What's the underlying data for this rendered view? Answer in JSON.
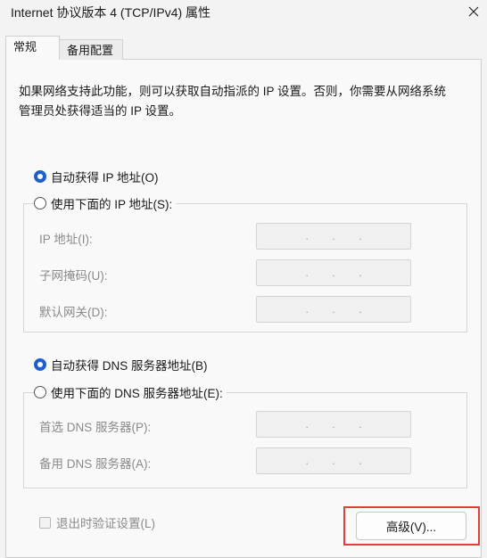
{
  "window": {
    "title": "Internet 协议版本 4 (TCP/IPv4) 属性"
  },
  "tabs": [
    {
      "label": "常规",
      "active": true
    },
    {
      "label": "备用配置",
      "active": false
    }
  ],
  "description": "如果网络支持此功能，则可以获取自动指派的 IP 设置。否则，你需要从网络系统管理员处获得适当的 IP 设置。",
  "ip": {
    "auto_label": "自动获得 IP 地址(O)",
    "auto_selected": true,
    "manual_label": "使用下面的 IP 地址(S):",
    "fields": [
      {
        "label": "IP 地址(I):",
        "value": ". . ."
      },
      {
        "label": "子网掩码(U):",
        "value": ". . ."
      },
      {
        "label": "默认网关(D):",
        "value": ". . ."
      }
    ]
  },
  "dns": {
    "auto_label": "自动获得 DNS 服务器地址(B)",
    "auto_selected": true,
    "manual_label": "使用下面的 DNS 服务器地址(E):",
    "fields": [
      {
        "label": "首选 DNS 服务器(P):",
        "value": ". . ."
      },
      {
        "label": "备用 DNS 服务器(A):",
        "value": ". . ."
      }
    ]
  },
  "validate_checkbox": {
    "label": "退出时验证设置(L)",
    "checked": false,
    "enabled": false
  },
  "advanced_button": {
    "label": "高级(V)..."
  },
  "colors": {
    "accent": "#1e5fd0",
    "highlight": "#e0403a"
  }
}
